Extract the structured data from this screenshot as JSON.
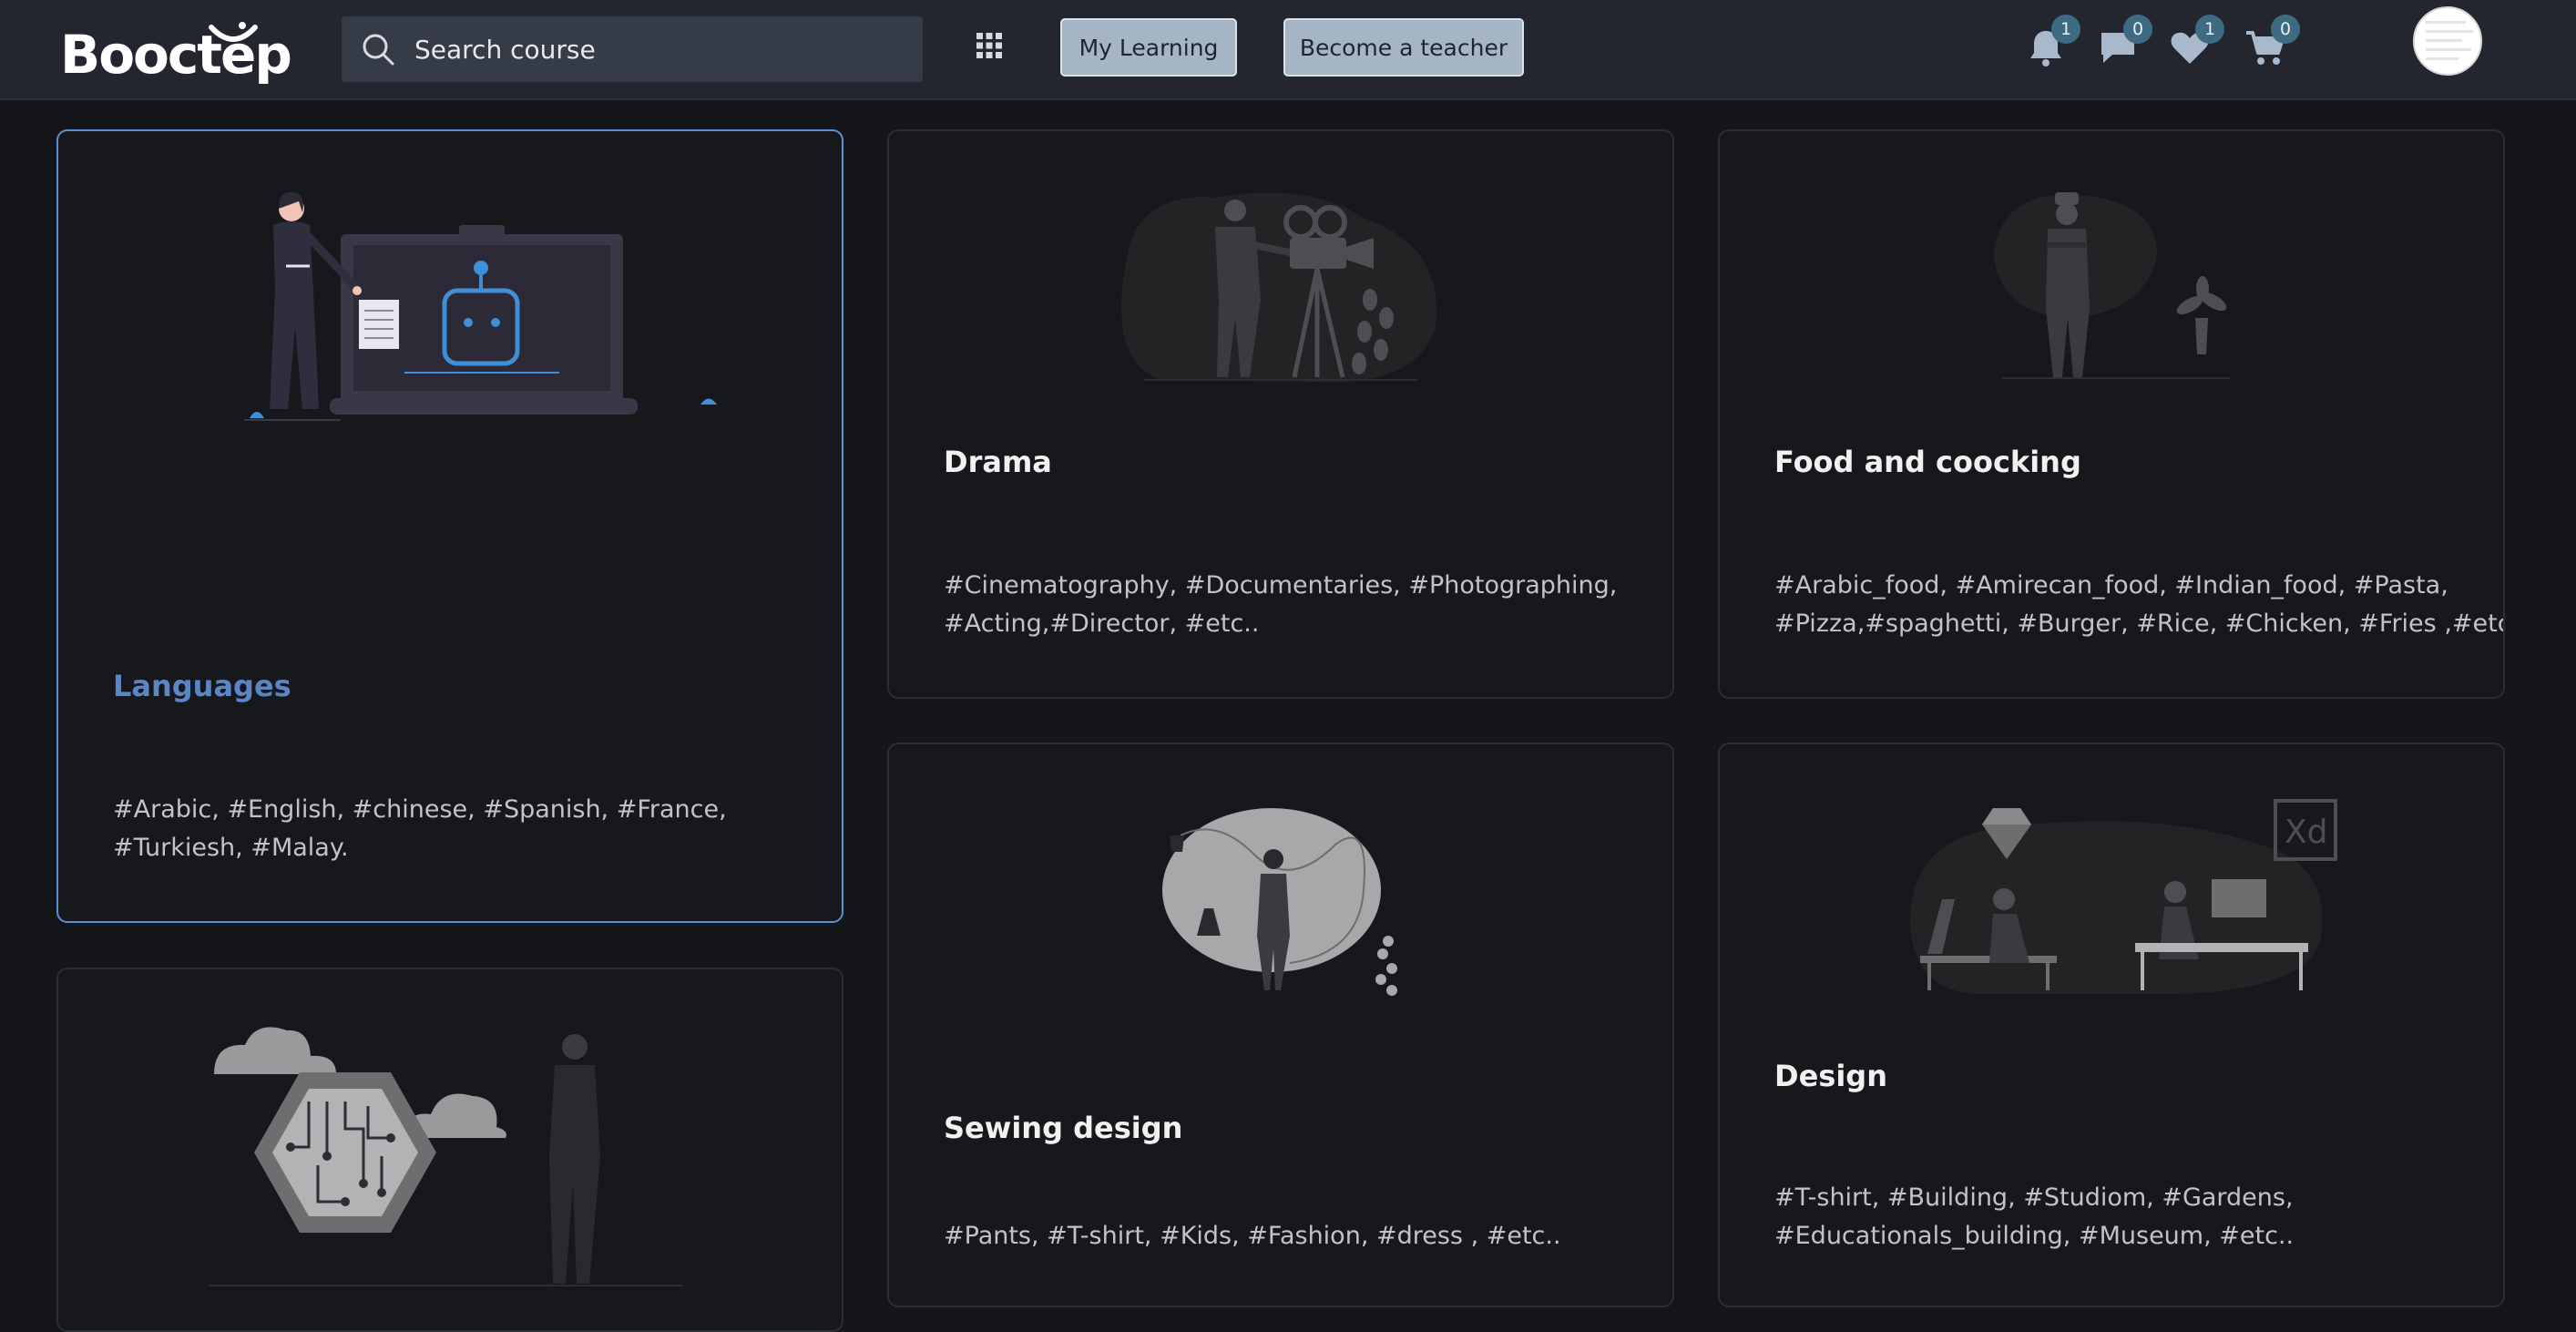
{
  "app": {
    "logo_text": "Booctep"
  },
  "search": {
    "placeholder": "Search course"
  },
  "header": {
    "my_learning_label": "My Learning",
    "become_teacher_label": "Become a teacher",
    "notifications_count": "1",
    "messages_count": "0",
    "wishlist_count": "1",
    "cart_count": "0"
  },
  "categories": [
    {
      "title": "Languages",
      "tags_line1": "#Arabic, #English, #chinese, #Spanish, #France,",
      "tags_line2": "#Turkiesh, #Malay."
    },
    {
      "title": "Drama",
      "tags_line1": "#Cinematography, #Documentaries, #Photographing,",
      "tags_line2": "#Acting,#Director, #etc.."
    },
    {
      "title": "Food and coocking",
      "tags_line1": "#Arabic_food, #Amirecan_food, #Indian_food, #Pasta,",
      "tags_line2": "#Pizza,#spaghetti, #Burger, #Rice, #Chicken, #Fries ,#etc.."
    },
    {
      "title": "Sewing design",
      "tags_line1": "#Pants, #T-shirt, #Kids, #Fashion, #dress , #etc..",
      "tags_line2": ""
    },
    {
      "title": "Design",
      "tags_line1": "#T-shirt, #Building, #Studiom, #Gardens,",
      "tags_line2": "#Educationals_building, #Museum, #etc.."
    },
    {
      "title": "",
      "tags_line1": "",
      "tags_line2": ""
    }
  ],
  "colors": {
    "accent": "#5a86c5",
    "header_bg": "#23262f",
    "page_bg": "#151619",
    "badge_bg": "#3e6b82",
    "button_bg": "#a6b5c6"
  },
  "icons": [
    "search-icon",
    "apps-grid-icon",
    "bell-icon",
    "chat-icon",
    "heart-icon",
    "cart-icon"
  ]
}
